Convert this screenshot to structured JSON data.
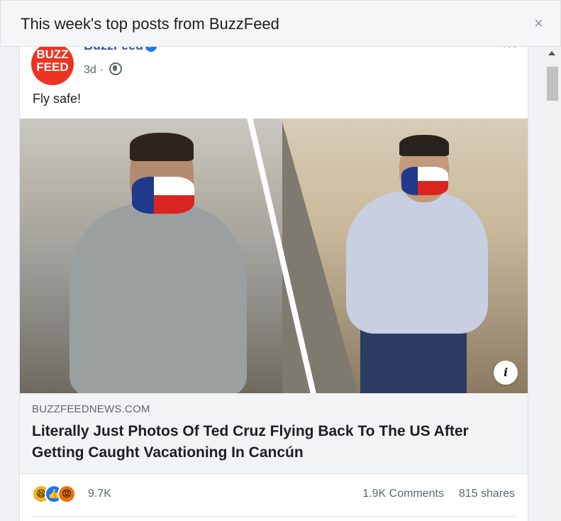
{
  "dialog": {
    "title": "This week's top posts from BuzzFeed",
    "close_icon": "×"
  },
  "post": {
    "avatar_text_1": "BUZZ",
    "avatar_text_2": "FEED",
    "page_name": "BuzzFeed",
    "verified_icon": "✓",
    "time": "3d",
    "separator": "·",
    "more_icon": "•••",
    "text": "Fly safe!",
    "info_icon": "i",
    "link": {
      "domain": "BUZZFEEDNEWS.COM",
      "title": "Literally Just Photos Of Ted Cruz Flying Back To The US After Getting Caught Vacationing In Cancún"
    },
    "reactions": {
      "haha_icon": "😆",
      "like_icon": "👍",
      "angry_icon": "😡",
      "count": "9.7K"
    },
    "comments": "1.9K Comments",
    "shares": "815 shares"
  },
  "colors": {
    "link_blue": "#385898",
    "brand_red": "#ee3322",
    "facebook_blue": "#1877f2"
  }
}
